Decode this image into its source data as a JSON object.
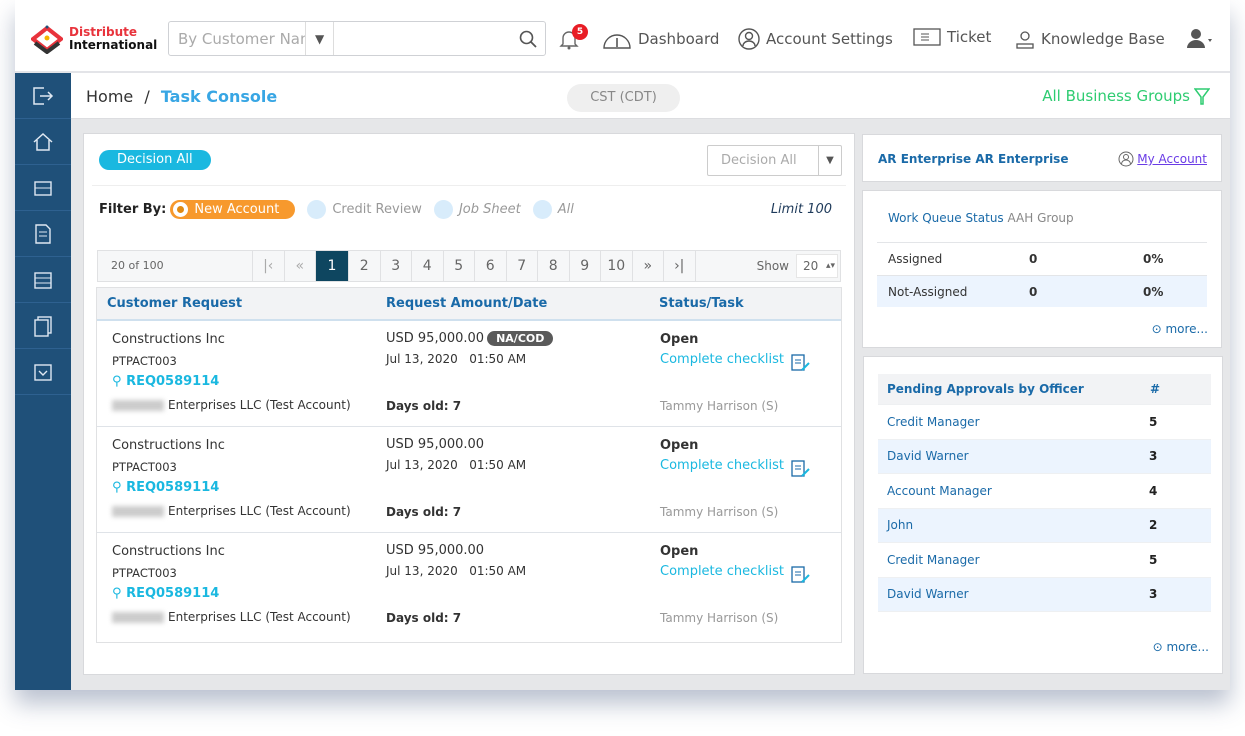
{
  "header": {
    "logo": {
      "line1": "Distribute",
      "line2": "International"
    },
    "search": {
      "field_placeholder": "By Customer Name",
      "value": ""
    },
    "notifications": {
      "count": "5"
    },
    "nav": [
      {
        "label": "Dashboard",
        "icon": "speedometer-icon"
      },
      {
        "label": "Account Settings",
        "icon": "user-circle-icon"
      },
      {
        "label": "Ticket",
        "icon": "ticket-icon"
      },
      {
        "label": "Knowledge Base",
        "icon": "lightbulb-icon"
      }
    ]
  },
  "breadcrumb": {
    "home": "Home",
    "sep": "/",
    "current": "Task Console"
  },
  "timezone": "CST (CDT)",
  "business_groups": "All Business Groups",
  "main": {
    "decision_pill": "Decision All",
    "decision_select": "Decision All",
    "filter_label": "Filter By:",
    "filters": [
      {
        "label": "New Account",
        "selected": true
      },
      {
        "label": "Credit Review",
        "selected": false
      },
      {
        "label": "Job Sheet",
        "selected": false
      },
      {
        "label": "All",
        "selected": false
      }
    ],
    "limit": "Limit 100",
    "pager": {
      "count": "20 of 100",
      "pages": [
        "1",
        "2",
        "3",
        "4",
        "5",
        "6",
        "7",
        "8",
        "9",
        "10"
      ],
      "current": "1",
      "show_label": "Show",
      "show_value": "20"
    },
    "columns": [
      "Customer Request",
      "Request Amount/Date",
      "Status/Task"
    ],
    "rows": [
      {
        "customer": "Constructions Inc",
        "code": "PTPACT003",
        "req": "REQ0589114",
        "company": "Enterprises LLC (Test Account)",
        "amount": "USD 95,000.00",
        "tag": "NA/COD",
        "date": "Jul 13, 2020",
        "time": "01:50 AM",
        "days": "Days old: 7",
        "status": "Open",
        "task": "Complete checklist",
        "assignee": "Tammy Harrison (S)"
      },
      {
        "customer": "Constructions Inc",
        "code": "PTPACT003",
        "req": "REQ0589114",
        "company": "Enterprises LLC (Test Account)",
        "amount": "USD 95,000.00",
        "tag": "",
        "date": "Jul 13, 2020",
        "time": "01:50 AM",
        "days": "Days old: 7",
        "status": "Open",
        "task": "Complete checklist",
        "assignee": "Tammy Harrison (S)"
      },
      {
        "customer": "Constructions Inc",
        "code": "PTPACT003",
        "req": "REQ0589114",
        "company": "Enterprises LLC (Test Account)",
        "amount": "USD 95,000.00",
        "tag": "",
        "date": "Jul 13, 2020",
        "time": "01:50 AM",
        "days": "Days old: 7",
        "status": "Open",
        "task": "Complete checklist",
        "assignee": "Tammy Harrison (S)"
      }
    ]
  },
  "account": {
    "name": "AR Enterprise AR Enterprise",
    "link": "My Account"
  },
  "work_queue": {
    "title": "Work Queue Status",
    "group": "AAH Group",
    "rows": [
      {
        "label": "Assigned",
        "count": "0",
        "pct": "0%"
      },
      {
        "label": "Not-Assigned",
        "count": "0",
        "pct": "0%"
      }
    ],
    "more": "more..."
  },
  "pending": {
    "title": "Pending Approvals by Officer",
    "col": "#",
    "rows": [
      {
        "name": "Credit Manager",
        "count": "5"
      },
      {
        "name": "David Warner",
        "count": "3"
      },
      {
        "name": "Account Manager",
        "count": "4"
      },
      {
        "name": "John",
        "count": "2"
      },
      {
        "name": "Credit Manager",
        "count": "5"
      },
      {
        "name": "David Warner",
        "count": "3"
      }
    ],
    "more": "more..."
  },
  "colors": {
    "sidebar": "#1f5079",
    "accent": "#1ab8e0",
    "filter_active": "#f7992d",
    "pager_active": "#0e4660",
    "business_groups": "#2ecc71",
    "brand_red": "#e8333c"
  }
}
